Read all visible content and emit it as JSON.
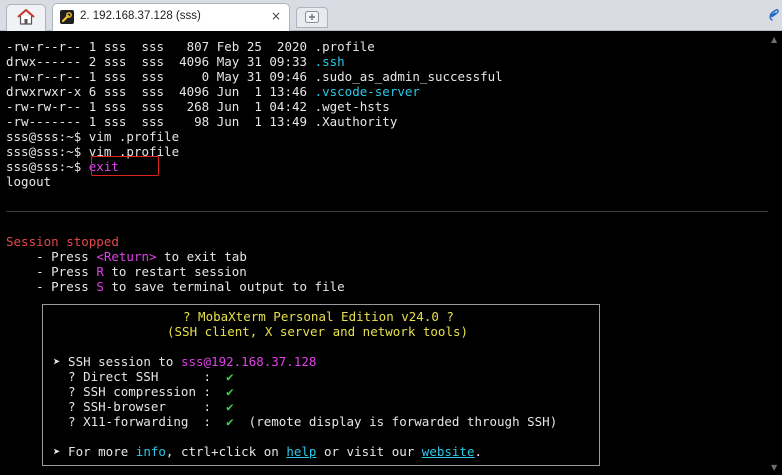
{
  "tabs": {
    "session_label": "2. 192.168.37.128 (sss)",
    "close_glyph": "×"
  },
  "terminal": {
    "ls": [
      {
        "perms": "-rw-r--r--",
        "links": "1",
        "user": "sss",
        "group": "sss",
        "size": "807",
        "month": "Feb",
        "day": "25",
        "time": "2020",
        "name": "profile_file"
      },
      {
        "perms": "drwx------",
        "links": "2",
        "user": "sss",
        "group": "sss",
        "size": "4096",
        "month": "May",
        "day": "31",
        "time": "09:33",
        "name": "ssh_dir"
      },
      {
        "perms": "-rw-r--r--",
        "links": "1",
        "user": "sss",
        "group": "sss",
        "size": "0",
        "month": "May",
        "day": "31",
        "time": "09:46",
        "name": "sudo_file"
      },
      {
        "perms": "drwxrwxr-x",
        "links": "6",
        "user": "sss",
        "group": "sss",
        "size": "4096",
        "month": "Jun",
        "day": "1",
        "time": "13:46",
        "name": "vscode_dir"
      },
      {
        "perms": "-rw-rw-r--",
        "links": "1",
        "user": "sss",
        "group": "sss",
        "size": "268",
        "month": "Jun",
        "day": "1",
        "time": "04:42",
        "name": "wget_file"
      },
      {
        "perms": "-rw-------",
        "links": "1",
        "user": "sss",
        "group": "sss",
        "size": "98",
        "month": "Jun",
        "day": "1",
        "time": "13:49",
        "name": "xauth_file"
      }
    ],
    "ls_lines": [
      "-rw-r--r-- 1 sss  sss   807 Feb 25  2020 ",
      "drwx------ 2 sss  sss  4096 May 31 09:33 ",
      "-rw-r--r-- 1 sss  sss     0 May 31 09:46 ",
      "drwxrwxr-x 6 sss  sss  4096 Jun  1 13:46 ",
      "-rw-rw-r-- 1 sss  sss   268 Jun  1 04:42 ",
      "-rw------- 1 sss  sss    98 Jun  1 13:49 "
    ],
    "ls_names": [
      ".profile",
      ".ssh",
      ".sudo_as_admin_successful",
      ".vscode-server",
      ".wget-hsts",
      ".Xauthority"
    ],
    "prompt": "sss@sss:~$ ",
    "cmd1": "vim .profile",
    "cmd2": "vim .profile",
    "cmd3": "exit",
    "logout": "logout",
    "session_stopped": "Session stopped",
    "press1_pre": "    - Press ",
    "press1_key": "<Return>",
    "press1_post": " to exit tab",
    "press2_pre": "    - Press ",
    "press2_key": "R",
    "press2_post": " to restart session",
    "press3_pre": "    - Press ",
    "press3_key": "S",
    "press3_post": " to save terminal output to file"
  },
  "info": {
    "title": "? MobaXterm Personal Edition v24.0 ?",
    "subtitle": "(SSH client, X server and network tools)",
    "ssh_arrow": "➤",
    "ssh_prefix": " SSH session to ",
    "ssh_target": "sss@192.168.37.128",
    "features": [
      {
        "label": "  ? Direct SSH      :  ",
        "mark": "✔",
        "note": ""
      },
      {
        "label": "  ? SSH compression :  ",
        "mark": "✔",
        "note": ""
      },
      {
        "label": "  ? SSH-browser     :  ",
        "mark": "✔",
        "note": ""
      },
      {
        "label": "  ? X11-forwarding  :  ",
        "mark": "✔",
        "note": "  (remote display is forwarded through SSH)"
      }
    ],
    "more_arrow": "➤",
    "more_pre": " For more ",
    "more_info": "info",
    "more_mid": ", ctrl+click on ",
    "more_help": "help",
    "more_mid2": " or visit our ",
    "more_site": "website",
    "more_end": "."
  },
  "colors": {
    "cyan": "#2ec8e6",
    "red": "#e5484d",
    "magenta": "#e040e8",
    "yellow": "#e6e04a",
    "green": "#3fd046",
    "highlight_box": "#e0221c"
  }
}
